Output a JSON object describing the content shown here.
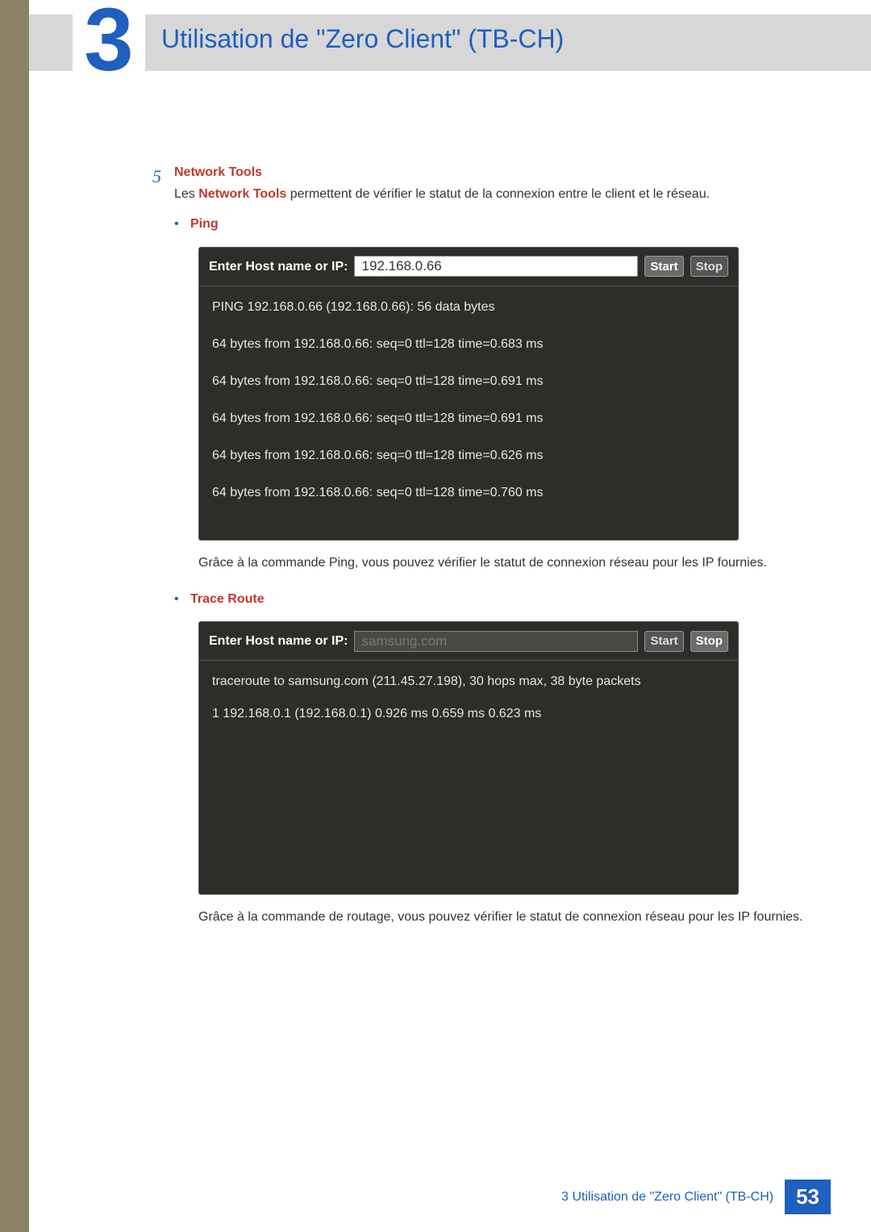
{
  "header": {
    "chapter_number": "3",
    "title": "Utilisation de \"Zero Client\" (TB-CH)"
  },
  "section": {
    "step_number": "5",
    "step_title": "Network Tools",
    "intro_prefix": "Les ",
    "intro_bold": "Network Tools",
    "intro_suffix": " permettent de vérifier le statut de la connexion entre le client et le réseau."
  },
  "ping": {
    "label": "Ping",
    "input_label": "Enter Host name or IP:",
    "input_value": "192.168.0.66",
    "start_label": "Start",
    "stop_label": "Stop",
    "output": [
      "PING 192.168.0.66 (192.168.0.66): 56 data bytes",
      "64 bytes from 192.168.0.66: seq=0 ttl=128 time=0.683 ms",
      "64 bytes from 192.168.0.66: seq=0 ttl=128 time=0.691 ms",
      "64 bytes from 192.168.0.66: seq=0 ttl=128 time=0.691 ms",
      "64 bytes from 192.168.0.66: seq=0 ttl=128 time=0.626 ms",
      "64 bytes from 192.168.0.66: seq=0 ttl=128 time=0.760 ms"
    ],
    "description": "Grâce à la commande Ping, vous pouvez vérifier le statut de connexion réseau pour les IP fournies."
  },
  "trace": {
    "label": "Trace Route",
    "input_label": "Enter Host name or IP:",
    "input_value": "samsung.com",
    "start_label": "Start",
    "stop_label": "Stop",
    "output": [
      "traceroute to samsung.com (211.45.27.198), 30 hops max, 38 byte packets",
      "1  192.168.0.1 (192.168.0.1)  0.926 ms  0.659 ms  0.623 ms"
    ],
    "description": "Grâce à la commande de routage, vous pouvez vérifier le statut de connexion réseau pour les IP fournies."
  },
  "footer": {
    "text": "3 Utilisation de \"Zero Client\" (TB-CH)",
    "page_number": "53"
  }
}
